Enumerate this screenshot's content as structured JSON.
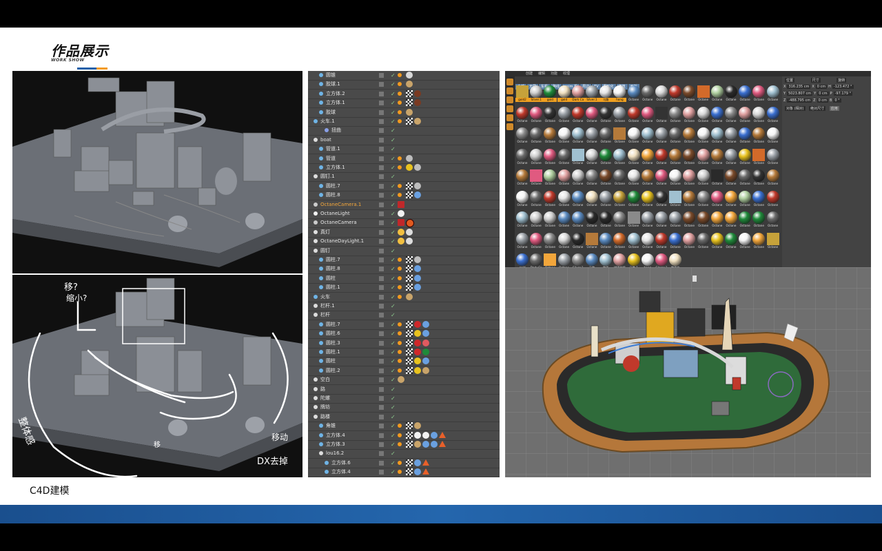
{
  "header": {
    "title": "作品展示",
    "subtitle": "WORK SHOW"
  },
  "colors": {
    "accent_blue": "#1f5fa8",
    "accent_orange": "#f39a1e",
    "bottom_band": "#1d5a9e"
  },
  "caption": "C4D建模",
  "sketch_notes": {
    "note1": "移?",
    "note2": "缩小?",
    "note3": "整体感",
    "note4": "移动",
    "note5": "DX去掉",
    "note6": "移"
  },
  "object_manager": {
    "rows": [
      {
        "name": "圆锥",
        "indent": 1,
        "icon": "cone-icon",
        "tags": [
          "orange",
          "cube"
        ]
      },
      {
        "name": "胶球.1",
        "indent": 1,
        "icon": "cone-icon",
        "tags": [
          "orange",
          "tan"
        ]
      },
      {
        "name": "立方体.2",
        "indent": 1,
        "icon": "cone-icon",
        "tags": [
          "orange",
          "check",
          "brown"
        ]
      },
      {
        "name": "立方体.1",
        "indent": 1,
        "icon": "cone-icon",
        "tags": [
          "orange",
          "check",
          "brown"
        ]
      },
      {
        "name": "胶球",
        "indent": 1,
        "icon": "cone-icon",
        "tags": [
          "orange",
          "tan"
        ]
      },
      {
        "name": "火车.1",
        "indent": 0,
        "icon": "cone-icon",
        "tags": [
          "orange",
          "check",
          "tan"
        ]
      },
      {
        "name": "扭曲",
        "indent": 2,
        "icon": "bend-icon",
        "tags": []
      },
      {
        "name": "boat",
        "indent": 0,
        "icon": "null-icon",
        "tags": []
      },
      {
        "name": "管道.1",
        "indent": 1,
        "icon": "tube-icon",
        "tags": []
      },
      {
        "name": "管道",
        "indent": 1,
        "icon": "tube-icon",
        "tags": [
          "orange",
          "gray"
        ]
      },
      {
        "name": "立方体.1",
        "indent": 1,
        "icon": "cone-icon",
        "tags": [
          "orange",
          "yellow",
          "gray"
        ]
      },
      {
        "name": "圆钉.1",
        "indent": 0,
        "icon": "null-icon",
        "tags": []
      },
      {
        "name": "圆柱.7",
        "indent": 1,
        "icon": "cone-icon",
        "tags": [
          "orange",
          "check",
          "gray"
        ]
      },
      {
        "name": "圆柱.8",
        "indent": 1,
        "icon": "cone-icon",
        "tags": [
          "orange",
          "check",
          "blue"
        ]
      },
      {
        "name": "OctaneCamera.1",
        "indent": 0,
        "icon": "camera-icon",
        "tags": [
          "camred"
        ],
        "highlight": true
      },
      {
        "name": "OctaneLight",
        "indent": 0,
        "icon": "light-icon",
        "tags": [
          "white"
        ]
      },
      {
        "name": "OctaneCamera",
        "indent": 0,
        "icon": "camera-icon",
        "tags": [
          "camred",
          "forbid"
        ]
      },
      {
        "name": "真灯",
        "indent": 0,
        "icon": "daylight-icon",
        "tags": [
          "sun",
          "gear"
        ]
      },
      {
        "name": "OctaneDayLight.1",
        "indent": 0,
        "icon": "daylight-icon",
        "tags": [
          "sun",
          "gear"
        ]
      },
      {
        "name": "圆钉",
        "indent": 0,
        "icon": "null-icon",
        "tags": []
      },
      {
        "name": "圆柱.7",
        "indent": 1,
        "icon": "cone-icon",
        "tags": [
          "orange",
          "check",
          "gray"
        ]
      },
      {
        "name": "圆柱.8",
        "indent": 1,
        "icon": "cone-icon",
        "tags": [
          "orange",
          "check",
          "blue"
        ]
      },
      {
        "name": "圆柱",
        "indent": 1,
        "icon": "cone-icon",
        "tags": [
          "orange",
          "check",
          "blue"
        ]
      },
      {
        "name": "圆柱.1",
        "indent": 1,
        "icon": "cone-icon",
        "tags": [
          "orange",
          "check",
          "blue"
        ]
      },
      {
        "name": "火车",
        "indent": 0,
        "icon": "cone-icon",
        "tags": [
          "orange",
          "tan"
        ]
      },
      {
        "name": "栏杆.1",
        "indent": 0,
        "icon": "null-icon",
        "tags": []
      },
      {
        "name": "栏杆",
        "indent": 0,
        "icon": "null-icon",
        "tags": []
      },
      {
        "name": "圆柱.7",
        "indent": 1,
        "icon": "cone-icon",
        "tags": [
          "orange",
          "check",
          "red",
          "blue"
        ]
      },
      {
        "name": "圆柱.6",
        "indent": 1,
        "icon": "cone-icon",
        "tags": [
          "orange",
          "check",
          "yellow",
          "blue"
        ]
      },
      {
        "name": "圆柱.3",
        "indent": 1,
        "icon": "cone-icon",
        "tags": [
          "orange",
          "check",
          "red",
          "pink"
        ]
      },
      {
        "name": "圆柱.1",
        "indent": 1,
        "icon": "cone-icon",
        "tags": [
          "orange",
          "check",
          "red",
          "green"
        ]
      },
      {
        "name": "圆柱",
        "indent": 1,
        "icon": "cone-icon",
        "tags": [
          "orange",
          "check",
          "yellow",
          "blue"
        ]
      },
      {
        "name": "圆柱.2",
        "indent": 1,
        "icon": "cone-icon",
        "tags": [
          "orange",
          "check",
          "yellow",
          "tan"
        ]
      },
      {
        "name": "空白",
        "indent": 0,
        "icon": "null-icon",
        "tags": [
          "tan"
        ]
      },
      {
        "name": "路",
        "indent": 0,
        "icon": "null-icon",
        "tags": []
      },
      {
        "name": "陀螺",
        "indent": 0,
        "icon": "null-icon",
        "tags": []
      },
      {
        "name": "牌坊",
        "indent": 0,
        "icon": "null-icon",
        "tags": []
      },
      {
        "name": "路楼",
        "indent": 0,
        "icon": "null-icon",
        "tags": []
      },
      {
        "name": "角锥",
        "indent": 1,
        "icon": "cone-icon",
        "tags": [
          "orange",
          "check",
          "tan"
        ]
      },
      {
        "name": "立方体.4",
        "indent": 1,
        "icon": "cone-icon",
        "tags": [
          "orange",
          "check",
          "white",
          "white",
          "blue",
          "tri"
        ]
      },
      {
        "name": "立方体.3",
        "indent": 1,
        "icon": "cone-icon",
        "tags": [
          "orange",
          "check",
          "tan",
          "blue",
          "blue",
          "tri"
        ]
      },
      {
        "name": "lou16.2",
        "indent": 1,
        "icon": "null-icon",
        "tags": []
      },
      {
        "name": "立方体.6",
        "indent": 2,
        "icon": "cone-icon",
        "tags": [
          "orange",
          "check",
          "blue",
          "tri"
        ]
      },
      {
        "name": "立方体.4",
        "indent": 2,
        "icon": "cone-icon",
        "tags": [
          "orange",
          "check",
          "blue",
          "tri"
        ]
      }
    ]
  },
  "material_manager": {
    "menu": [
      "创建",
      "编辑",
      "功能",
      "纹理"
    ],
    "tabs": [
      "全部",
      "无层",
      "车机",
      "路线",
      "anim 机",
      "周边",
      "TV",
      "图形化",
      "建筑",
      "面板"
    ],
    "row_labels": [
      [
        "gold2",
        "Silver.1",
        "gold",
        "gold",
        "Dark Ca",
        "Silver.1",
        "马路",
        "hong"
      ],
      [],
      [],
      [],
      [],
      [],
      [],
      [],
      [
        "gold",
        "Dark Ca",
        "Octane",
        "Octane",
        "Silver.1",
        "马路",
        "路面",
        "描面材质",
        "马路.1",
        "hong",
        "Glossy.1",
        "路面化"
      ]
    ],
    "generic_label": "Octane",
    "attributes": {
      "header_labels": [
        "位置",
        "尺寸",
        "旋转"
      ],
      "x": [
        "316.235 cm",
        "0 cm",
        "-123.472 °"
      ],
      "y": [
        "5023.807 cm",
        "0 cm",
        "-97.179 °"
      ],
      "z": [
        "-488.795 cm",
        "0 cm",
        "0 °"
      ],
      "mode": "对象 (相对)",
      "size_mode": "绝对尺寸",
      "apply": "应用"
    }
  }
}
